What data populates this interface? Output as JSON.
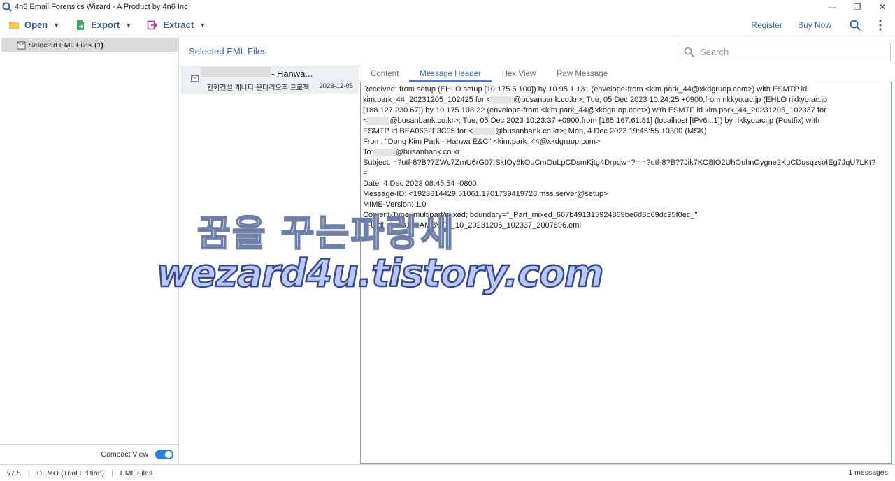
{
  "window": {
    "title": "4n6 Email Forensics Wizard - A Product by 4n6 Inc",
    "minimize": "—",
    "restore": "❐",
    "close": "✕"
  },
  "toolbar": {
    "open_label": "Open",
    "export_label": "Export",
    "extract_label": "Extract",
    "register_label": "Register",
    "buy_now_label": "Buy Now"
  },
  "sidebar": {
    "item_label": "Selected EML Files",
    "item_count": "(1)",
    "compact_view_label": "Compact View"
  },
  "main": {
    "title": "Selected EML Files",
    "search_placeholder": "Search"
  },
  "message_list": [
    {
      "sender": "- Hanwa...",
      "subject": "한화건설 캐나다 온타리오주 프로젝",
      "date": "2023-12-05"
    }
  ],
  "tabs": [
    "Content",
    "Message Header",
    "Hex View",
    "Raw Message"
  ],
  "header_lines": {
    "l1": "Received: from setup (EHLO setup [10.175.5.100])      by 10.95.1.131 (envelope-from <kim.park_44@xkdgruop.com>)         with ESMTP id",
    "l2a": "kim.park_44_20231205_102425 for <",
    "l2b": "@busanbank.co.kr>;           Tue, 05 Dec 2023 10:24:25 +0900,from rikkyo.ac.jp (EHLO rikkyo.ac.jp",
    "l3": "[188.127.230.67]) by 10.175.108.22 (envelope-from <kim.park_44@xkdgruop.com>)       with ESMTP id kim.park_44_20231205_102337 for",
    "l4a": "<",
    "l4b": "@busanbank.co.kr>;           Tue, 05 Dec 2023 10:23:37 +0900,from [185.167.61.81] (localhost [IPv6:::1])        by rikkyo.ac.jp (Postfix) with",
    "l5a": "ESMTP id BEA0632F3C95  for <",
    "l5b": "@busanbank.co.kr>; Mon,  4 Dec 2023 19:45:55 +0300 (MSK)",
    "l6": "From: \"Dong Kim Park - Hanwa E&C\" <kim.park_44@xkdgruop.com>",
    "l7a": "To:",
    "l7b": "@busanbank.co.kr",
    "l8": "Subject: =?utf-8?B?7ZWc7ZmU6rG07ISkIOy6kOuCmOuLpCDsmKjtg4Drpqw=?= =?utf-8?B?7Jik7KO8IO2UhOuhnOygne2KuCDqsqzsoIEg7JqU7LKt?",
    "l9": "=",
    "l10": "Date: 4 Dec 2023 08:45:54 -0800",
    "l11": "Message-ID: <1923814429.51061.1701739419728.mss.server@setup>",
    "l12": "MIME-Version: 1.0",
    "l13": "Content-Type: multipart/mixed; boundary=\"_Part_mixed_667b491315924869be6d3b69dc95f0ec_\"",
    "l14": "X-Uidl: 4e2B1vSAMBVFK_10_20231205_102337_2007896.eml"
  },
  "watermark": {
    "line1": "꿈을 꾸는파랑새",
    "line2": "wezard4u.tistory.com"
  },
  "statusbar": {
    "version": "v7.5",
    "edition": "DEMO (Trial Edition)",
    "mode": "EML Files",
    "message_count": "1 messages"
  },
  "colors": {
    "accent": "#2f7fd6",
    "link": "#3c6aa8",
    "selection": "#d9d9d9"
  }
}
